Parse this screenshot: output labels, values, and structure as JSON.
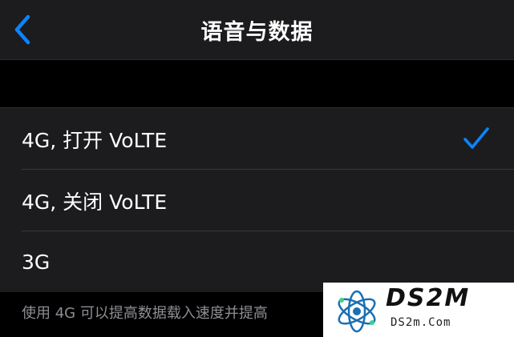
{
  "navbar": {
    "title": "语音与数据",
    "back_icon": "chevron-left-icon"
  },
  "options": [
    {
      "label": "4G, 打开 VoLTE",
      "selected": true
    },
    {
      "label": "4G, 关闭 VoLTE",
      "selected": false
    },
    {
      "label": "3G",
      "selected": false
    }
  ],
  "footer": {
    "text": "使用 4G 可以提高数据载入速度并提高"
  },
  "watermark": {
    "brand": "DS2M",
    "domain": "DS2m.Com"
  },
  "colors": {
    "accent": "#0a84ff",
    "background": "#000000",
    "cell": "#1c1c1e",
    "separator": "#38383a",
    "secondary_text": "#8e8e93"
  }
}
